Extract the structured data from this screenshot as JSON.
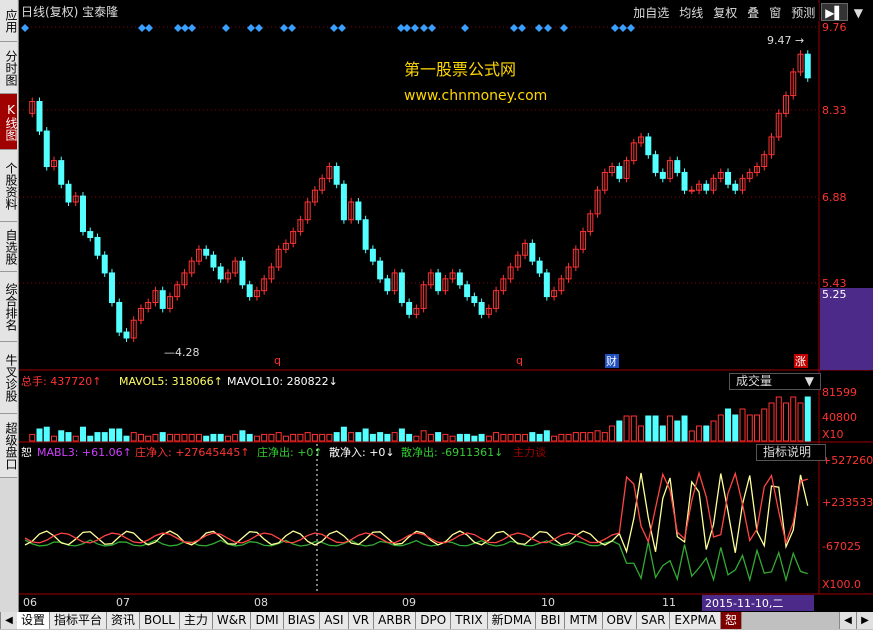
{
  "window": {
    "title": "日线(复权) 宝泰隆"
  },
  "toolbar": {
    "add_self": "加自选",
    "ma": "均线",
    "restore": "复权",
    "overlay": "叠",
    "window": "窗",
    "forecast": "预测",
    "menu_icon": "arrow-icon",
    "close": "▼"
  },
  "sidebar": [
    {
      "label": "应用",
      "active": false
    },
    {
      "label": "分时图",
      "active": false
    },
    {
      "label": "K线图",
      "active": true
    },
    {
      "label": "个股资料",
      "active": false
    },
    {
      "label": "自选股",
      "active": false
    },
    {
      "label": "综合排名",
      "active": false
    },
    {
      "label": "牛叉诊股",
      "active": false
    },
    {
      "label": "超级盘口",
      "active": false
    }
  ],
  "watermark": {
    "line1": "第一股票公式网",
    "line2": "www.chnmoney.com"
  },
  "price_axis": {
    "ticks": [
      "9.76",
      "8.33",
      "6.88",
      "5.43"
    ],
    "current": "5.25"
  },
  "price_annotations": {
    "high": "9.47",
    "low": "4.28"
  },
  "markers": {
    "q1": "q",
    "q2": "q",
    "cai": "财",
    "zhang": "涨"
  },
  "volume": {
    "total_label": "总手:",
    "total_value": "437720",
    "ma5_label": "MAVOL5:",
    "ma5_value": "318066",
    "ma10_label": "MAVOL10:",
    "ma10_value": "280822",
    "selector": "成交量",
    "axis": [
      "81599",
      "40800",
      "X10"
    ]
  },
  "indicator": {
    "name": "MABL3:",
    "name_value": "+61.06",
    "zhuang_in_label": "庄净入:",
    "zhuang_in_value": "+27645445",
    "zhuang_out_label": "庄净出:",
    "zhuang_out_value": "+0",
    "san_in_label": "散净入:",
    "san_in_value": "+0",
    "san_out_label": "散净出:",
    "san_out_value": "-6911361",
    "main_label": "主力谈",
    "help": "指标说明",
    "axis": [
      "+527260",
      "+233533",
      "-67025",
      "X100.0"
    ],
    "prefix": "恕"
  },
  "x_axis": {
    "labels": [
      "06",
      "07",
      "08",
      "09",
      "10",
      "11"
    ],
    "date_badge": "2015-11-10,二"
  },
  "bottom_tabs": [
    "设置",
    "指标平台",
    "资讯",
    "BOLL",
    "主力",
    "W&R",
    "DMI",
    "BIAS",
    "ASI",
    "VR",
    "ARBR",
    "DPO",
    "TRIX",
    "新DMA",
    "BBI",
    "MTM",
    "OBV",
    "SAR",
    "EXPMA",
    "恕"
  ],
  "colors": {
    "up": "#ff3333",
    "down": "#54ffff",
    "grid": "#800000",
    "accent": "#a00000"
  }
}
